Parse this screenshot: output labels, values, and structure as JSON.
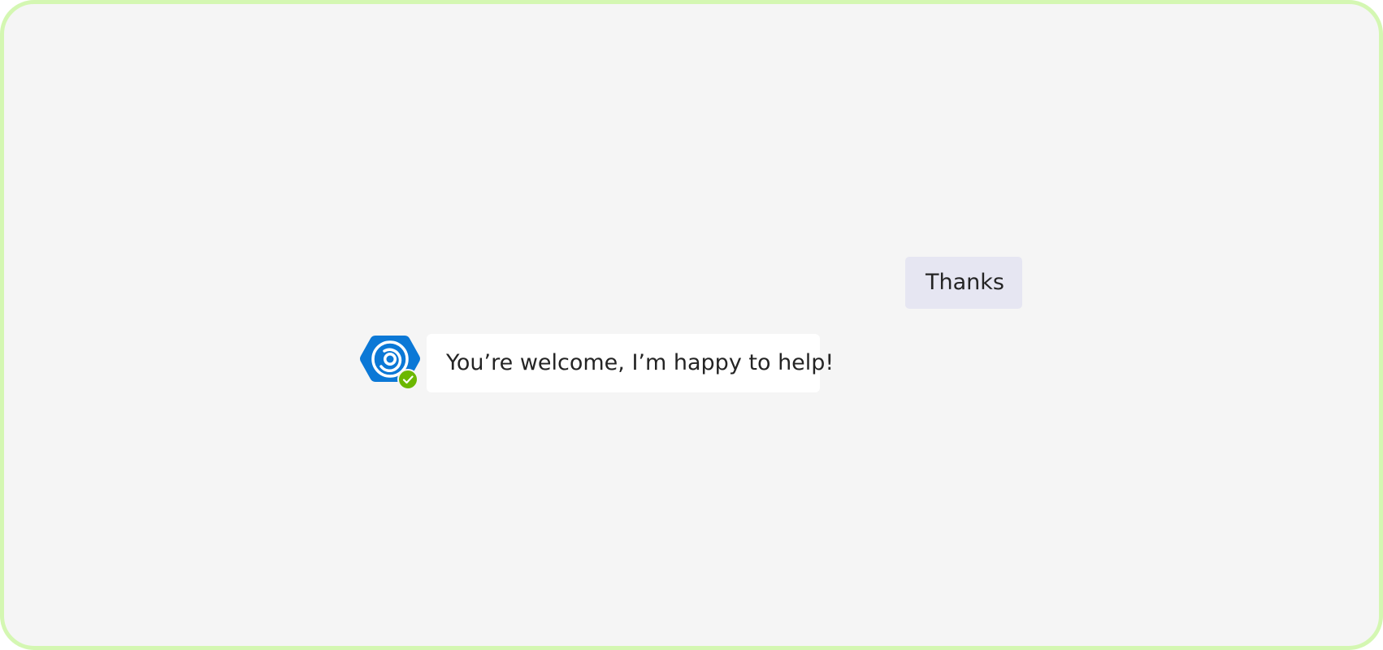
{
  "conversation": {
    "user_message": "Thanks",
    "bot_message": "You’re welcome, I’m happy to help!"
  },
  "bot": {
    "avatar_icon": "copilot-hexagon-icon",
    "presence_icon": "available-check-icon",
    "status": "available"
  },
  "colors": {
    "frame_border": "#d4f7b2",
    "background": "#f5f5f5",
    "user_bubble": "#e6e6f2",
    "bot_bubble": "#ffffff",
    "avatar_blue": "#0b78d6",
    "presence_green": "#6bb700",
    "text": "#242424"
  }
}
